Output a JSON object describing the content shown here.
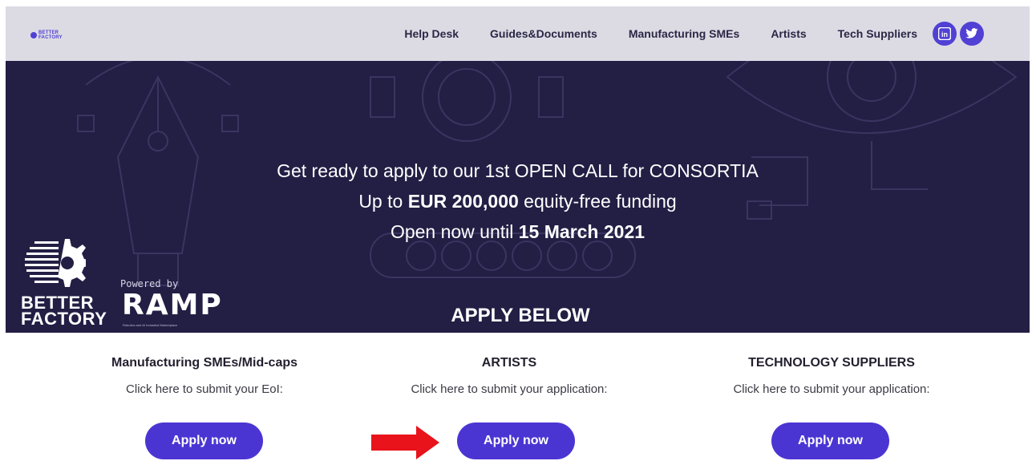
{
  "nav": {
    "logo_text_line1": "BETTER",
    "logo_text_line2": "FACTORY",
    "links": [
      "Help Desk",
      "Guides&Documents",
      "Manufacturing SMEs",
      "Artists",
      "Tech Suppliers"
    ],
    "social": [
      {
        "name": "linkedin-icon",
        "glyph": "in"
      },
      {
        "name": "twitter-icon",
        "glyph": "t"
      }
    ]
  },
  "hero": {
    "line1": "Get ready to apply to our 1st OPEN CALL for CONSORTIA",
    "line2_pre": "Up to ",
    "line2_bold": "EUR 200,000",
    "line2_post": " equity-free funding",
    "line3_pre": "Open now until ",
    "line3_bold": "15 March 2021",
    "apply_below": "APPLY BELOW",
    "brand_line1": "BETTER",
    "brand_line2": "FACTORY",
    "powered_by": "Powered by",
    "ramp": "RAMP",
    "ramp_tagline": "Robotics and AI Industrial Marketplace"
  },
  "columns": [
    {
      "title": "Manufacturing SMEs/Mid-caps",
      "subtitle": "Click here to submit your EoI:",
      "button": "Apply now"
    },
    {
      "title": "ARTISTS",
      "subtitle": "Click here to submit your application:",
      "button": "Apply now"
    },
    {
      "title": "TECHNOLOGY SUPPLIERS",
      "subtitle": "Click here to submit your application:",
      "button": "Apply now"
    }
  ],
  "colors": {
    "accent": "#4a35d3",
    "hero_bg": "#231e44",
    "nav_bg": "#dcdbe4",
    "arrow": "#e8131b"
  }
}
